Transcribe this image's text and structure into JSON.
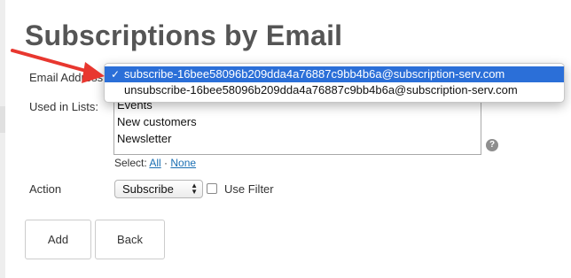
{
  "page": {
    "title": "Subscriptions by Email"
  },
  "form": {
    "email_label": "Email Address",
    "lists_label": "Used in Lists:",
    "lists": [
      "Events",
      "New customers",
      "Newsletter"
    ],
    "select_label": "Select:",
    "select_all": "All",
    "select_separator": "·",
    "select_none": "None",
    "action_label": "Action",
    "action_value": "Subscribe",
    "use_filter_label": "Use Filter",
    "use_filter_checked": false,
    "help_icon_glyph": "?"
  },
  "email_dropdown": {
    "options": [
      {
        "label": "subscribe-16bee58096b209dda4a76887c9bb4b6a@subscription-serv.com",
        "selected": true
      },
      {
        "label": "unsubscribe-16bee58096b209dda4a76887c9bb4b6a@subscription-serv.com",
        "selected": false
      }
    ],
    "check_glyph": "✓"
  },
  "buttons": {
    "add": "Add",
    "back": "Back"
  },
  "colors": {
    "selection": "#2b6fd8",
    "link": "#1a6fb3",
    "annotation_arrow": "#e8372f"
  }
}
